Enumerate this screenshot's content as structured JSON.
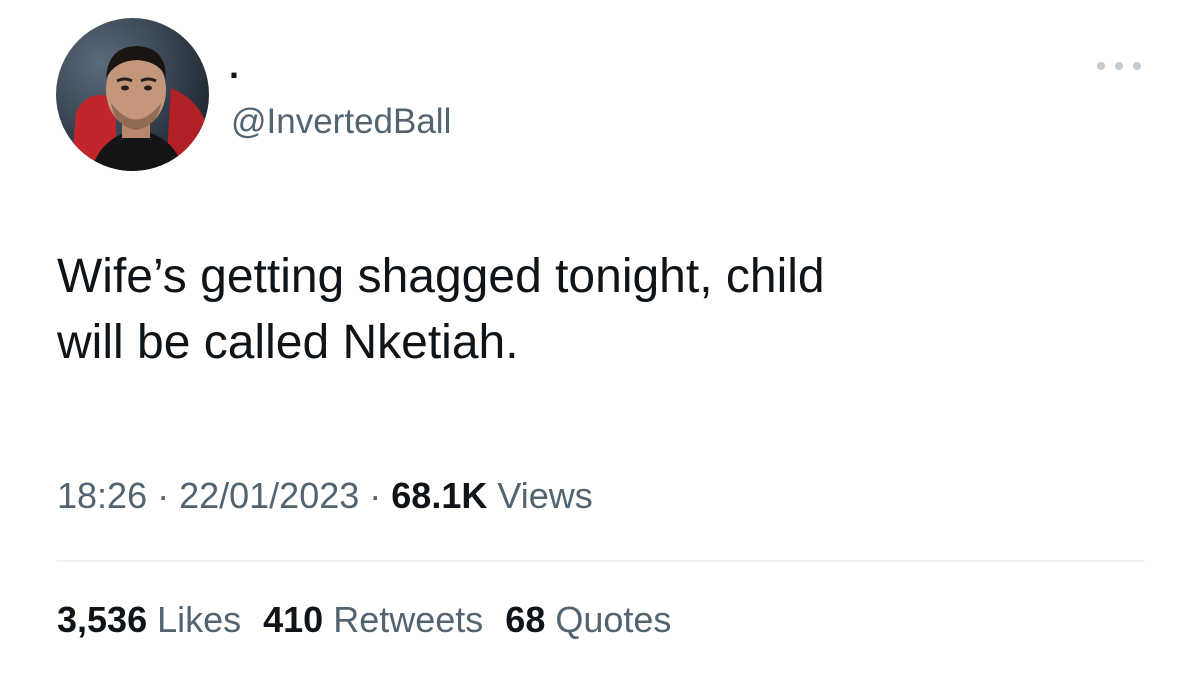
{
  "author": {
    "display_name": ".",
    "handle": "@InvertedBall",
    "avatar": "profile-photo"
  },
  "menu_icon": "ellipsis-icon",
  "tweet": {
    "text": "Wife’s getting shagged tonight, child\nwill be called Nketiah."
  },
  "meta": {
    "time": "18:26",
    "sep1": " · ",
    "date": "22/01/2023",
    "sep2": " · ",
    "views_count": "68.1K",
    "views_label": " Views"
  },
  "stats": {
    "likes_count": "3,536",
    "likes_label": " Likes",
    "retweets_count": "410",
    "retweets_label": " Retweets",
    "quotes_count": "68",
    "quotes_label": " Quotes"
  },
  "colors": {
    "text_primary": "#0f1419",
    "text_secondary": "#536471",
    "divider": "#eff3f4"
  }
}
